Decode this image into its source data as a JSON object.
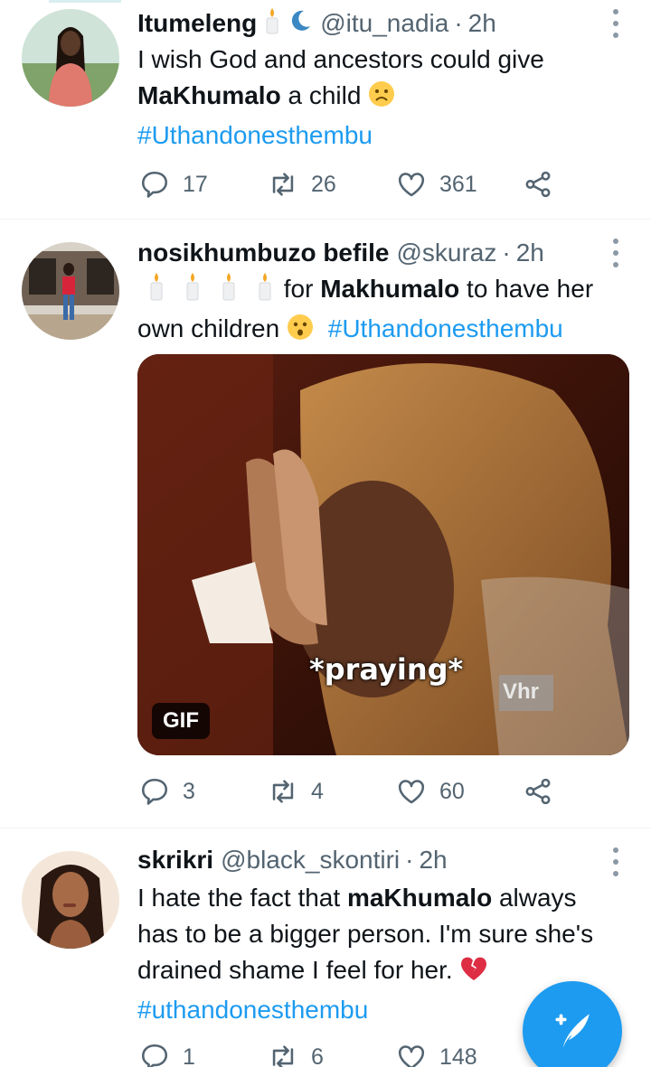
{
  "colors": {
    "accent": "#1d9bf0",
    "text": "#0f1419",
    "muted": "#536471",
    "heart_red": "#e0245e"
  },
  "tweets": [
    {
      "name": "Itumeleng",
      "name_icons": [
        "candle-icon",
        "crescent-moon-icon"
      ],
      "handle": "@itu_nadia",
      "dot": "·",
      "time": "2h",
      "text_parts": {
        "line1": "I wish God and ancestors could give",
        "bold": "MaKhumalo",
        "rest": " a child",
        "emoji": "frowning-face-icon",
        "hashtag": "#Uthandonesthembu"
      },
      "replies": "17",
      "retweets": "26",
      "likes": "361"
    },
    {
      "name": "nosikhumbuzo befile",
      "handle": "@skuraz",
      "dot": "·",
      "time": "2h",
      "text_parts": {
        "emoji_prefix": [
          "candle-icon",
          "candle-icon",
          "candle-icon",
          "candle-icon"
        ],
        "pre": " for ",
        "bold": "Makhumalo",
        "post": " to have her",
        "line2": "own children ",
        "emoji": "hushed-face-icon",
        "hashtag": "#Uthandonesthembu"
      },
      "media": {
        "caption": "*praying*",
        "badge": "GIF",
        "watermark": "Vhr"
      },
      "replies": "3",
      "retweets": "4",
      "likes": "60"
    },
    {
      "name": "skrikri",
      "handle": "@black_skontiri",
      "dot": "·",
      "time": "2h",
      "text_parts": {
        "pre": "I hate the fact that ",
        "bold": "maKhumalo",
        "post": " always",
        "line2": "has to be a bigger person. I'm sure she's",
        "line3": "drained shame I feel for her. ",
        "emoji": "broken-heart-icon",
        "hashtag": "#uthandonesthembu"
      },
      "replies": "1",
      "retweets": "6",
      "likes": "148"
    }
  ],
  "fab": {
    "icon": "compose-tweet-icon"
  }
}
